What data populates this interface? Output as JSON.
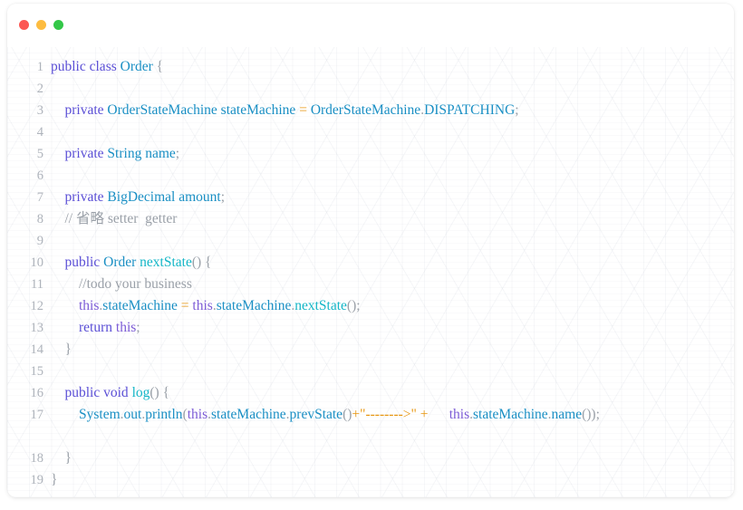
{
  "window": {
    "controls": [
      {
        "name": "close-button",
        "color": "#fc5753"
      },
      {
        "name": "minimize-button",
        "color": "#fdbc40"
      },
      {
        "name": "maximize-button",
        "color": "#33c748"
      }
    ]
  },
  "editor": {
    "language": "java",
    "theme_colors": {
      "background": "#ffffff",
      "line_number": "#aeb3bb",
      "keyword": "#5b4fd6",
      "type": "#1a8fc4",
      "method": "#14b6c7",
      "string": "#e8960f",
      "operator": "#e8960f",
      "comment": "#9aa0a8",
      "punctuation": "#9aa0a8"
    },
    "line_numbers": [
      "1",
      "2",
      "3",
      "4",
      "5",
      "6",
      "7",
      "8",
      "9",
      "10",
      "11",
      "12",
      "13",
      "14",
      "15",
      "16",
      "17",
      "18",
      "19"
    ],
    "lines": [
      {
        "n": "1",
        "text": "public class Order {"
      },
      {
        "n": "2",
        "text": ""
      },
      {
        "n": "3",
        "text": "    private OrderStateMachine stateMachine = OrderStateMachine.DISPATCHING;"
      },
      {
        "n": "4",
        "text": ""
      },
      {
        "n": "5",
        "text": "    private String name;"
      },
      {
        "n": "6",
        "text": ""
      },
      {
        "n": "7",
        "text": "    private BigDecimal amount;"
      },
      {
        "n": "8",
        "text": "    // 省略 setter  getter"
      },
      {
        "n": "9",
        "text": ""
      },
      {
        "n": "10",
        "text": "    public Order nextState() {"
      },
      {
        "n": "11",
        "text": "        //todo your business"
      },
      {
        "n": "12",
        "text": "        this.stateMachine = this.stateMachine.nextState();"
      },
      {
        "n": "13",
        "text": "        return this;"
      },
      {
        "n": "14",
        "text": "    }"
      },
      {
        "n": "15",
        "text": ""
      },
      {
        "n": "16",
        "text": "    public void log() {"
      },
      {
        "n": "17",
        "text": "        System.out.println(this.stateMachine.prevState()+\"-------->\" +      this.stateMachine.name());"
      },
      {
        "n": "18",
        "text": "    }"
      },
      {
        "n": "19",
        "text": "}"
      }
    ],
    "tokens": {
      "l1": [
        {
          "t": "public",
          "c": "kw"
        },
        {
          "t": " ",
          "c": "plain"
        },
        {
          "t": "class",
          "c": "kw"
        },
        {
          "t": " ",
          "c": "plain"
        },
        {
          "t": "Order",
          "c": "type"
        },
        {
          "t": " ",
          "c": "plain"
        },
        {
          "t": "{",
          "c": "punc"
        }
      ],
      "l3": [
        {
          "t": "    ",
          "c": "plain"
        },
        {
          "t": "private",
          "c": "kw"
        },
        {
          "t": " ",
          "c": "plain"
        },
        {
          "t": "OrderStateMachine",
          "c": "type"
        },
        {
          "t": " ",
          "c": "plain"
        },
        {
          "t": "stateMachine",
          "c": "var"
        },
        {
          "t": " ",
          "c": "plain"
        },
        {
          "t": "=",
          "c": "op"
        },
        {
          "t": " ",
          "c": "plain"
        },
        {
          "t": "OrderStateMachine",
          "c": "type"
        },
        {
          "t": ".",
          "c": "punc"
        },
        {
          "t": "DISPATCHING",
          "c": "const"
        },
        {
          "t": ";",
          "c": "punc"
        }
      ],
      "l5": [
        {
          "t": "    ",
          "c": "plain"
        },
        {
          "t": "private",
          "c": "kw"
        },
        {
          "t": " ",
          "c": "plain"
        },
        {
          "t": "String",
          "c": "type"
        },
        {
          "t": " ",
          "c": "plain"
        },
        {
          "t": "name",
          "c": "var"
        },
        {
          "t": ";",
          "c": "punc"
        }
      ],
      "l7": [
        {
          "t": "    ",
          "c": "plain"
        },
        {
          "t": "private",
          "c": "kw"
        },
        {
          "t": " ",
          "c": "plain"
        },
        {
          "t": "BigDecimal",
          "c": "type"
        },
        {
          "t": " ",
          "c": "plain"
        },
        {
          "t": "amount",
          "c": "var"
        },
        {
          "t": ";",
          "c": "punc"
        }
      ],
      "l8": [
        {
          "t": "    ",
          "c": "plain"
        },
        {
          "t": "// 省略 setter  getter",
          "c": "cmt"
        }
      ],
      "l10": [
        {
          "t": "    ",
          "c": "plain"
        },
        {
          "t": "public",
          "c": "kw"
        },
        {
          "t": " ",
          "c": "plain"
        },
        {
          "t": "Order",
          "c": "type"
        },
        {
          "t": " ",
          "c": "plain"
        },
        {
          "t": "nextState",
          "c": "method"
        },
        {
          "t": "()",
          "c": "punc"
        },
        {
          "t": " ",
          "c": "plain"
        },
        {
          "t": "{",
          "c": "punc"
        }
      ],
      "l11": [
        {
          "t": "        ",
          "c": "plain"
        },
        {
          "t": "//todo your business",
          "c": "cmt"
        }
      ],
      "l12": [
        {
          "t": "        ",
          "c": "plain"
        },
        {
          "t": "this",
          "c": "this"
        },
        {
          "t": ".",
          "c": "punc"
        },
        {
          "t": "stateMachine",
          "c": "var"
        },
        {
          "t": " ",
          "c": "plain"
        },
        {
          "t": "=",
          "c": "op"
        },
        {
          "t": " ",
          "c": "plain"
        },
        {
          "t": "this",
          "c": "this"
        },
        {
          "t": ".",
          "c": "punc"
        },
        {
          "t": "stateMachine",
          "c": "var"
        },
        {
          "t": ".",
          "c": "punc"
        },
        {
          "t": "nextState",
          "c": "method"
        },
        {
          "t": "()",
          "c": "punc"
        },
        {
          "t": ";",
          "c": "punc"
        }
      ],
      "l13": [
        {
          "t": "        ",
          "c": "plain"
        },
        {
          "t": "return",
          "c": "kw"
        },
        {
          "t": " ",
          "c": "plain"
        },
        {
          "t": "this",
          "c": "this"
        },
        {
          "t": ";",
          "c": "punc"
        }
      ],
      "l14": [
        {
          "t": "    ",
          "c": "plain"
        },
        {
          "t": "}",
          "c": "punc"
        }
      ],
      "l16": [
        {
          "t": "    ",
          "c": "plain"
        },
        {
          "t": "public",
          "c": "kw"
        },
        {
          "t": " ",
          "c": "plain"
        },
        {
          "t": "void",
          "c": "kw"
        },
        {
          "t": " ",
          "c": "plain"
        },
        {
          "t": "log",
          "c": "method"
        },
        {
          "t": "()",
          "c": "punc"
        },
        {
          "t": " ",
          "c": "plain"
        },
        {
          "t": "{",
          "c": "punc"
        }
      ],
      "l17": [
        {
          "t": "        ",
          "c": "plain"
        },
        {
          "t": "System",
          "c": "type"
        },
        {
          "t": ".",
          "c": "punc"
        },
        {
          "t": "out",
          "c": "var"
        },
        {
          "t": ".",
          "c": "punc"
        },
        {
          "t": "println",
          "c": "var"
        },
        {
          "t": "(",
          "c": "punc"
        },
        {
          "t": "this",
          "c": "this"
        },
        {
          "t": ".",
          "c": "punc"
        },
        {
          "t": "stateMachine",
          "c": "var"
        },
        {
          "t": ".",
          "c": "punc"
        },
        {
          "t": "prevState",
          "c": "var"
        },
        {
          "t": "()",
          "c": "punc"
        },
        {
          "t": "+",
          "c": "op"
        },
        {
          "t": "\"-------->\"",
          "c": "str"
        },
        {
          "t": " ",
          "c": "plain"
        },
        {
          "t": "+",
          "c": "op"
        },
        {
          "t": "      ",
          "c": "plain"
        },
        {
          "t": "this",
          "c": "this"
        },
        {
          "t": ".",
          "c": "punc"
        },
        {
          "t": "stateMachine",
          "c": "var"
        },
        {
          "t": ".",
          "c": "punc"
        },
        {
          "t": "name",
          "c": "var"
        },
        {
          "t": "())",
          "c": "punc"
        },
        {
          "t": ";",
          "c": "punc"
        }
      ],
      "l18": [
        {
          "t": "    ",
          "c": "plain"
        },
        {
          "t": "}",
          "c": "punc"
        }
      ],
      "l19": [
        {
          "t": "}",
          "c": "punc"
        }
      ]
    }
  }
}
